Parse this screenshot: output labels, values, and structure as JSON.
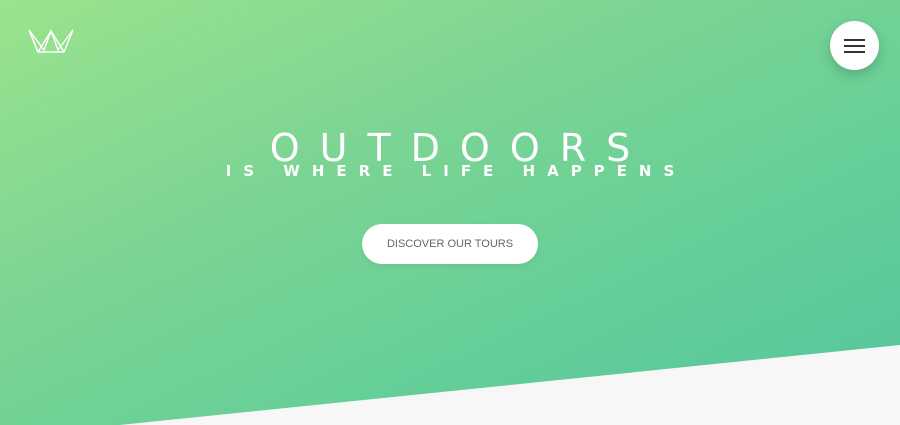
{
  "header": {
    "logo_icon": "crown-outline-icon",
    "menu_icon": "hamburger-menu-icon"
  },
  "hero": {
    "title": "OUTDOORS",
    "subtitle": "IS WHERE LIFE HAPPENS",
    "cta_label": "DISCOVER OUR TOURS"
  },
  "colors": {
    "gradient_start": "#9be38d",
    "gradient_end": "#55c59d",
    "text_light": "#ffffff",
    "button_bg": "#ffffff",
    "button_text": "#666666",
    "page_bg": "#f7f7f7"
  }
}
